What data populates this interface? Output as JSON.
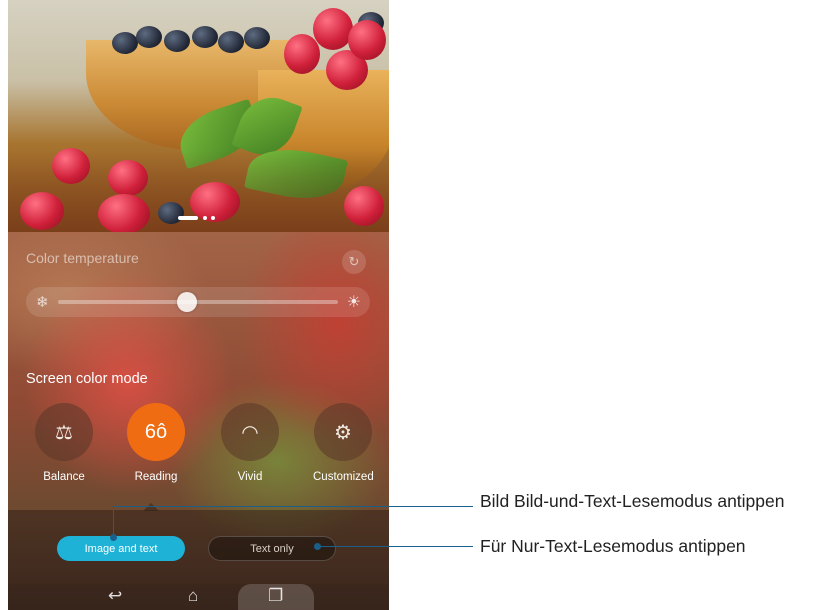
{
  "color_temperature": {
    "label": "Color temperature",
    "reset_icon": "refresh-icon",
    "cold_icon": "snowflake-icon",
    "warm_icon": "sun-icon",
    "level": 0.46
  },
  "screen_color_mode": {
    "label": "Screen color mode",
    "modes": [
      {
        "label": "Balance",
        "icon": "scale-icon",
        "icon_glyph": "⚖",
        "active": false
      },
      {
        "label": "Reading",
        "icon": "glasses-icon",
        "icon_glyph": "6ô",
        "active": true
      },
      {
        "label": "Vivid",
        "icon": "rainbow-icon",
        "icon_glyph": "◠",
        "active": false
      },
      {
        "label": "Customized",
        "icon": "custom-settings-icon",
        "icon_glyph": "⚙",
        "active": false
      }
    ]
  },
  "reading_mode": {
    "image_and_text_label": "Image and text",
    "text_only_label": "Text only"
  },
  "navbar": {
    "back_icon": "back-icon",
    "home_icon": "home-icon",
    "recent_icon": "recent-apps-icon"
  },
  "callouts": {
    "image_and_text": "Bild Bild-und-Text-Lesemodus antippen",
    "text_only": "Für Nur-Text-Lesemodus antippen"
  },
  "colors": {
    "accent_orange": "#ef6c12",
    "accent_cyan": "#1fb2d7",
    "callout_line": "#1a5f8a"
  }
}
